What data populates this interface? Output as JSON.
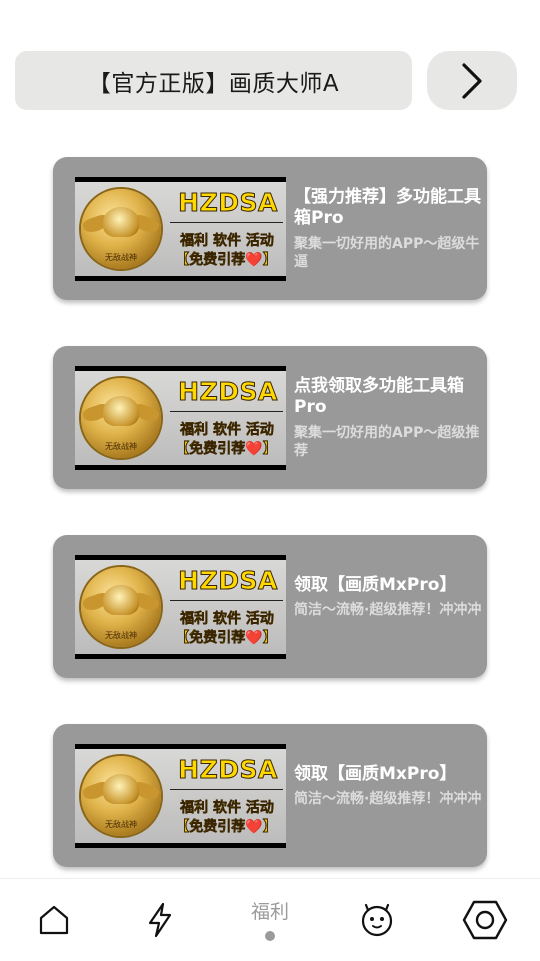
{
  "header": {
    "title": "【官方正版】画质大师A"
  },
  "cards": [
    {
      "thumb": {
        "title": "HZDSA",
        "line1": "福利 软件 活动",
        "line2": "【免费引荐❤️】",
        "badge_text": "无敌战神"
      },
      "title": "【强力推荐】多功能工具箱Pro",
      "desc": "聚集一切好用的APP～超级牛逼"
    },
    {
      "thumb": {
        "title": "HZDSA",
        "line1": "福利 软件 活动",
        "line2": "【免费引荐❤️】",
        "badge_text": "无敌战神"
      },
      "title": "点我领取多功能工具箱Pro",
      "desc": "聚集一切好用的APP～超级推荐"
    },
    {
      "thumb": {
        "title": "HZDSA",
        "line1": "福利 软件 活动",
        "line2": "【免费引荐❤️】",
        "badge_text": "无敌战神"
      },
      "title": "领取【画质MxPro】",
      "desc": "简洁～流畅·超级推荐！冲冲冲"
    },
    {
      "thumb": {
        "title": "HZDSA",
        "line1": "福利 软件 活动",
        "line2": "【免费引荐❤️】",
        "badge_text": "无敌战神"
      },
      "title": "领取【画质MxPro】",
      "desc": "简洁～流畅·超级推荐！冲冲冲"
    }
  ],
  "bottom_nav": {
    "items": [
      {
        "icon": "home-icon"
      },
      {
        "icon": "lightning-icon"
      },
      {
        "label": "福利",
        "active": true
      },
      {
        "icon": "face-icon"
      },
      {
        "icon": "settings-hexagon-icon"
      }
    ]
  },
  "colors": {
    "card_bg": "#9a9999",
    "pill_bg": "#e7e7e5",
    "thumb_accent": "#ffd800"
  }
}
